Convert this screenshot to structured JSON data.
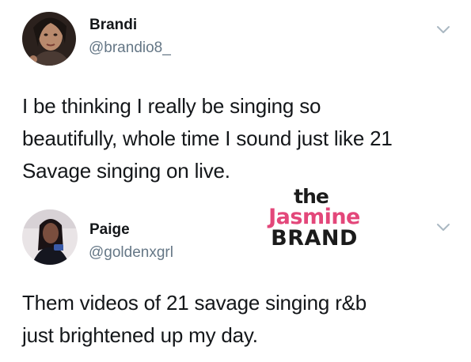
{
  "tweets": [
    {
      "display_name": "Brandi",
      "handle": "@brandio8_",
      "text": "I be thinking I really be singing so\nbeautifully, whole time I sound just like 21\nSavage singing on live."
    },
    {
      "display_name": "Paige",
      "handle": "@goldenxgrl",
      "text": "Them videos of 21 savage singing r&b\njust brightened up my day."
    }
  ],
  "watermark": {
    "line1": "the",
    "line2": "Jasmine",
    "line3": "BRAND"
  },
  "colors": {
    "text": "#14171a",
    "secondary": "#657786",
    "chevron": "#aab8c2",
    "watermark_pink": "#e3477a",
    "watermark_dark": "#1b1b1b"
  },
  "icons": {
    "menu": "chevron-down-icon"
  }
}
